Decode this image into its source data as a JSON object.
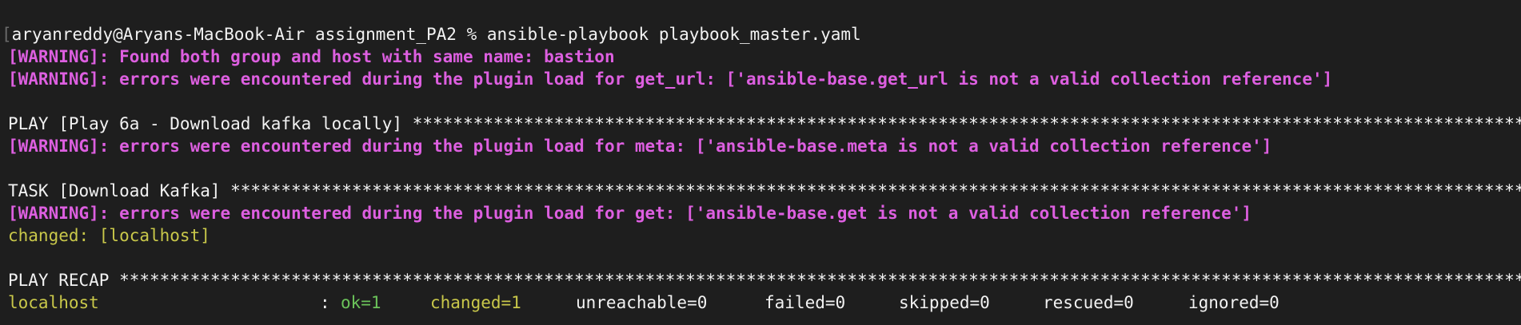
{
  "colors": {
    "background": "#1e1e1e",
    "text": "#f2f2f2",
    "warning": "#dd5fe0",
    "changed": "#c9c84a",
    "ok": "#6bc35a"
  },
  "terminal": {
    "prompt": "aryanreddy@Aryans-MacBook-Air assignment_PA2 % ansible-playbook playbook_master.yaml",
    "warning_bastion": "[WARNING]: Found both group and host with same name: bastion",
    "warning_get_url": "[WARNING]: errors were encountered during the plugin load for get_url: ['ansible-base.get_url is not a valid collection reference']",
    "play_header": "PLAY [Play 6a - Download kafka locally] *****************************************************************************************************************",
    "warning_meta": "[WARNING]: errors were encountered during the plugin load for meta: ['ansible-base.meta is not a valid collection reference']",
    "task_header": "TASK [Download Kafka] ***********************************************************************************************************************************",
    "warning_get": "[WARNING]: errors were encountered during the plugin load for get: ['ansible-base.get is not a valid collection reference']",
    "changed_line": "changed: [localhost]",
    "recap_header": "PLAY RECAP **********************************************************************************************************************************************",
    "recap": {
      "host": "localhost",
      "separator": ":",
      "ok": "ok=1",
      "changed": "changed=1",
      "unreachable": "unreachable=0",
      "failed": "failed=0",
      "skipped": "skipped=0",
      "rescued": "rescued=0",
      "ignored": "ignored=0"
    }
  }
}
